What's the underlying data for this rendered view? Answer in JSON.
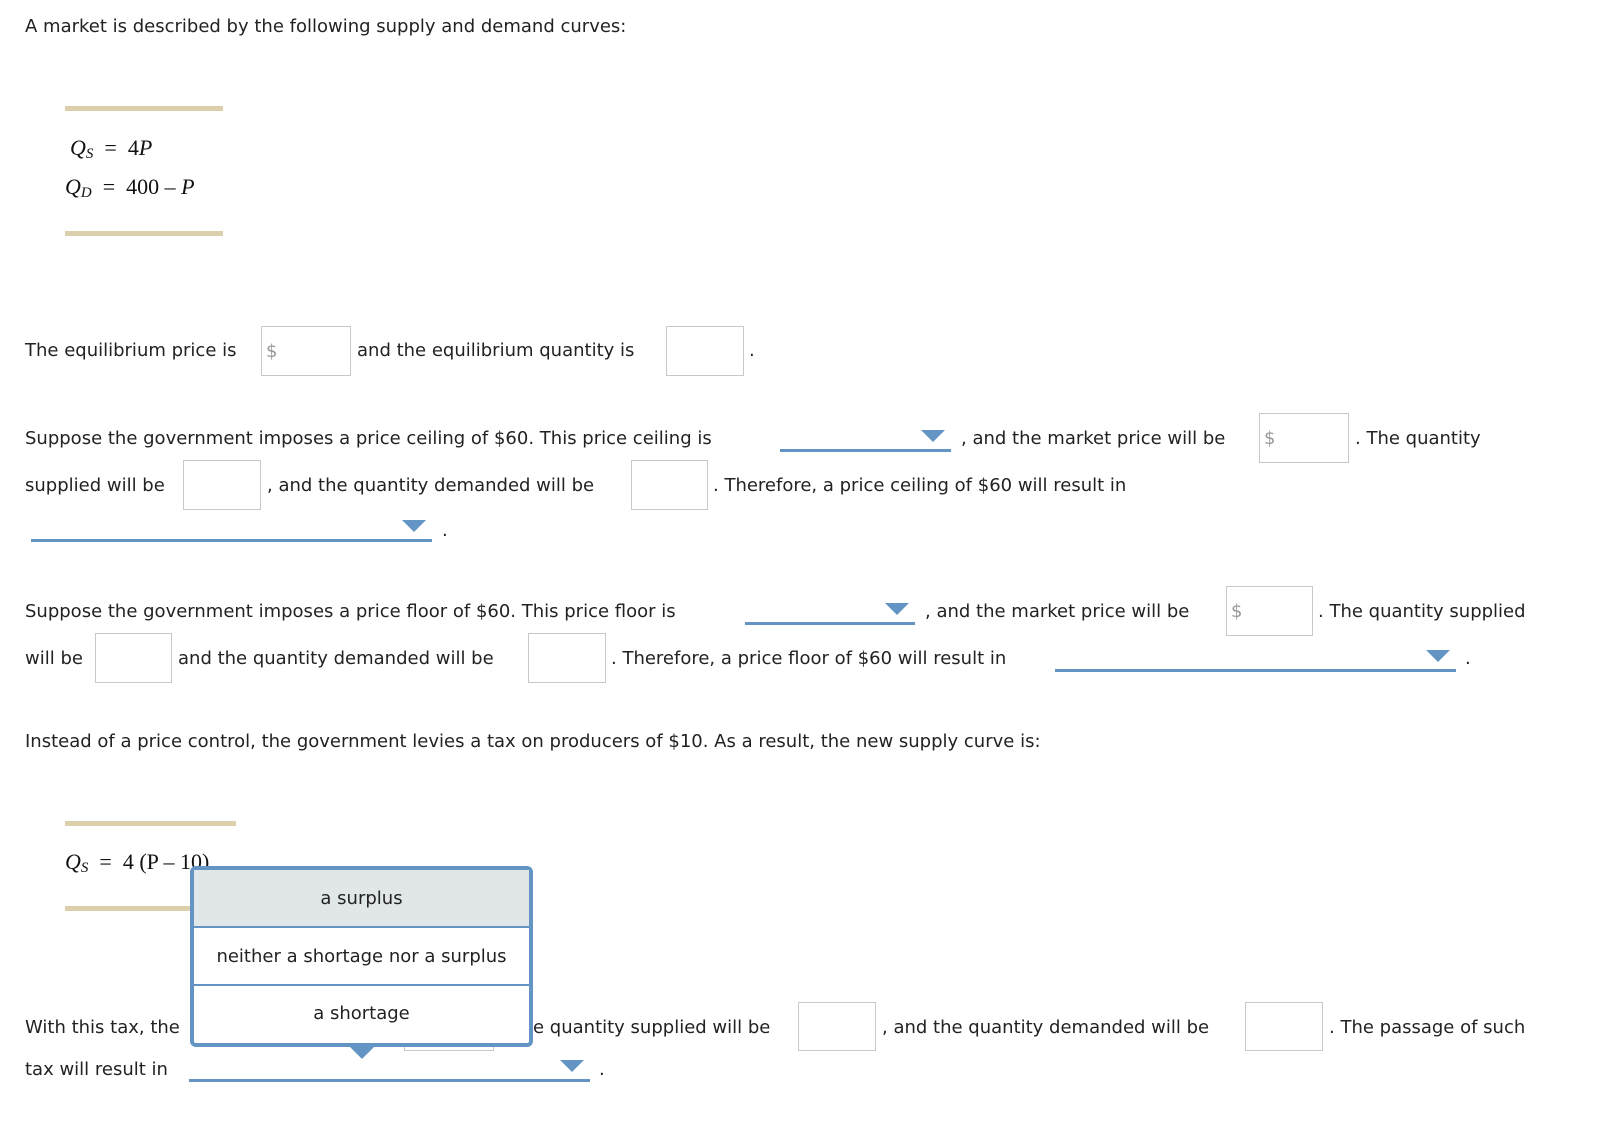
{
  "intro": "A market is described by the following supply and demand curves:",
  "equations1": {
    "qs_lhs": "Q",
    "qs_sub": "S",
    "qs_rhs_num": "4",
    "qs_rhs_var": "P",
    "qd_lhs": "Q",
    "qd_sub": "D",
    "qd_rhs_num": "400 – ",
    "qd_rhs_var": "P",
    "equals": "="
  },
  "equilibrium": {
    "text1": "The equilibrium price is",
    "text2": "and the equilibrium quantity is",
    "text3": ".",
    "currency": "$"
  },
  "ceiling": {
    "line1_a": "Suppose the government imposes a price ceiling of $60. This price ceiling is",
    "line1_b": ", and the market price will be",
    "line1_c": ". The quantity",
    "line2_a": "supplied will be",
    "line2_b": ", and the quantity demanded will be",
    "line2_c": ". Therefore, a price ceiling of $60 will result in",
    "line3_end": ".",
    "currency": "$"
  },
  "floor": {
    "line1_a": "Suppose the government imposes a price floor of $60. This price floor is",
    "line1_b": ", and the market price will be",
    "line1_c": ". The quantity supplied",
    "line2_a": "will be",
    "line2_b": "and the quantity demanded will be",
    "line2_c": ". Therefore, a price floor of $60 will result in",
    "line2_end": ".",
    "currency": "$"
  },
  "tax": {
    "intro": "Instead of a price control, the government levies a tax on producers of $10. As a result, the new supply curve is:",
    "eq_lhs": "Q",
    "eq_sub": "S",
    "eq_equals": "=",
    "eq_rhs": "4 (P – 10)",
    "line1_a": "With this tax, the",
    "line1_b": "e quantity supplied will be",
    "line1_c": ", and the quantity demanded will be",
    "line1_d": ". The passage of such",
    "line2_a": "tax will result in",
    "line2_end": "."
  },
  "dropdown_popup": {
    "options": [
      "a surplus",
      "neither a shortage nor a surplus",
      "a shortage"
    ],
    "highlighted_index": 0
  },
  "colors": {
    "accent": "#6394c4",
    "rule": "#dbd0ab",
    "highlight": "#e1e7e9"
  }
}
